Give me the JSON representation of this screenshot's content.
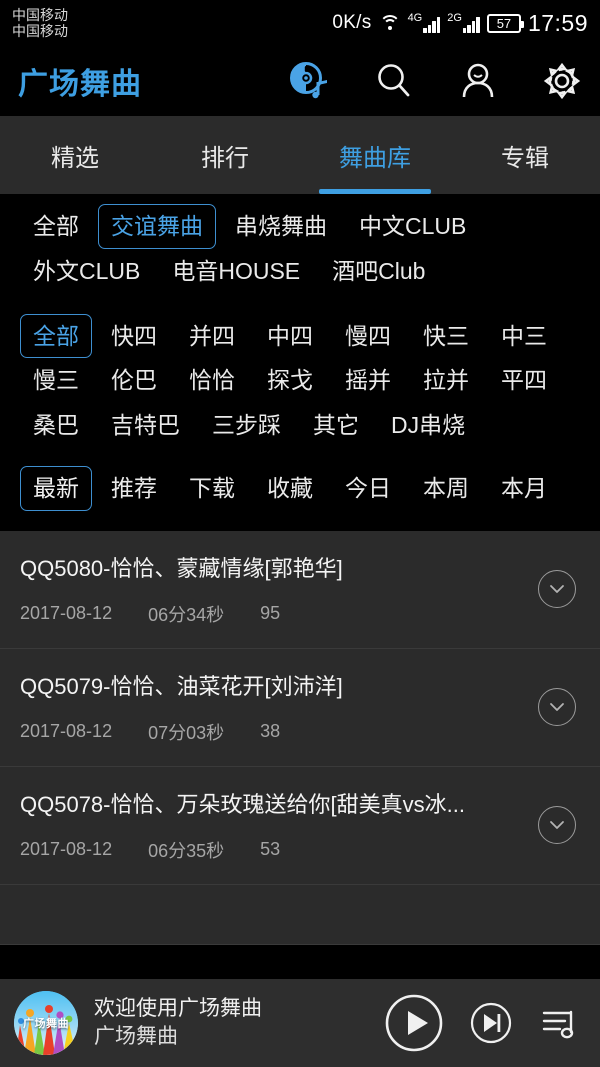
{
  "status_bar": {
    "carrier_line1": "中国移动",
    "carrier_line2": "中国移动",
    "network_speed": "0K/s",
    "wifi_icon": "wifi-icon",
    "sim1_label": "4G",
    "sim2_label": "2G",
    "battery_percent": "57",
    "time": "17:59"
  },
  "header": {
    "title": "广场舞曲",
    "icons": [
      {
        "name": "cd-music-icon"
      },
      {
        "name": "search-icon"
      },
      {
        "name": "user-icon"
      },
      {
        "name": "settings-gear-icon"
      }
    ]
  },
  "tabs": {
    "items": [
      {
        "label": "精选",
        "active": false
      },
      {
        "label": "排行",
        "active": false
      },
      {
        "label": "舞曲库",
        "active": true
      },
      {
        "label": "专辑",
        "active": false
      }
    ]
  },
  "filters": {
    "category": {
      "items": [
        {
          "label": "全部",
          "state": "normal"
        },
        {
          "label": "交谊舞曲",
          "state": "selected-blue"
        },
        {
          "label": "串烧舞曲",
          "state": "normal"
        },
        {
          "label": "中文CLUB",
          "state": "normal"
        },
        {
          "label": "外文CLUB",
          "state": "normal"
        },
        {
          "label": "电音HOUSE",
          "state": "normal"
        },
        {
          "label": "酒吧Club",
          "state": "normal"
        }
      ]
    },
    "style": {
      "items": [
        {
          "label": "全部",
          "state": "selected-blue"
        },
        {
          "label": "快四",
          "state": "normal"
        },
        {
          "label": "并四",
          "state": "normal"
        },
        {
          "label": "中四",
          "state": "normal"
        },
        {
          "label": "慢四",
          "state": "normal"
        },
        {
          "label": "快三",
          "state": "normal"
        },
        {
          "label": "中三",
          "state": "normal"
        },
        {
          "label": "慢三",
          "state": "normal"
        },
        {
          "label": "伦巴",
          "state": "normal"
        },
        {
          "label": "恰恰",
          "state": "normal"
        },
        {
          "label": "探戈",
          "state": "normal"
        },
        {
          "label": "摇并",
          "state": "normal"
        },
        {
          "label": "拉并",
          "state": "normal"
        },
        {
          "label": "平四",
          "state": "normal"
        },
        {
          "label": "桑巴",
          "state": "normal"
        },
        {
          "label": "吉特巴",
          "state": "normal"
        },
        {
          "label": "三步踩",
          "state": "normal"
        },
        {
          "label": "其它",
          "state": "normal"
        },
        {
          "label": "DJ串烧",
          "state": "normal"
        }
      ]
    },
    "sort": {
      "items": [
        {
          "label": "最新",
          "state": "selected-white"
        },
        {
          "label": "推荐",
          "state": "normal"
        },
        {
          "label": "下载",
          "state": "normal"
        },
        {
          "label": "收藏",
          "state": "normal"
        },
        {
          "label": "今日",
          "state": "normal"
        },
        {
          "label": "本周",
          "state": "normal"
        },
        {
          "label": "本月",
          "state": "normal"
        }
      ]
    }
  },
  "song_list": {
    "rows": [
      {
        "title": "QQ5080-恰恰、蒙藏情缘[郭艳华]",
        "date": "2017-08-12",
        "duration": "06分34秒",
        "count": "95"
      },
      {
        "title": "QQ5079-恰恰、油菜花开[刘沛洋]",
        "date": "2017-08-12",
        "duration": "07分03秒",
        "count": "38"
      },
      {
        "title": "QQ5078-恰恰、万朵玫瑰送给你[甜美真vs冰...",
        "date": "2017-08-12",
        "duration": "06分35秒",
        "count": "53"
      }
    ],
    "expand_icon": "chevron-down-icon"
  },
  "player": {
    "artwork_label": "广场舞曲",
    "track_title": "欢迎使用广场舞曲",
    "track_subtitle": "广场舞曲",
    "play_icon": "play-icon",
    "next_icon": "next-track-icon",
    "playlist_icon": "playlist-icon"
  },
  "colors": {
    "accent": "#3e9fe2",
    "background": "#000000",
    "surface": "#2b2b2b",
    "player_bg": "#2e2e2e",
    "text_primary": "#f2f2f2",
    "text_secondary": "#a6a6a6"
  }
}
